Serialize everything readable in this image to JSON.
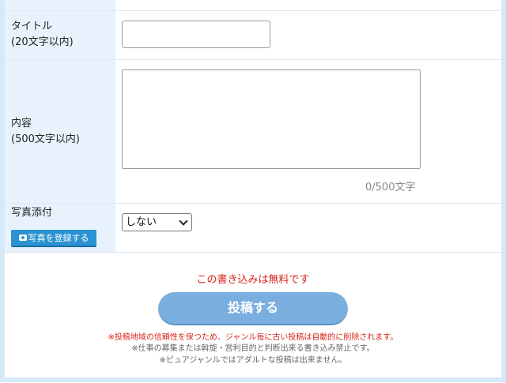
{
  "form": {
    "title_label_line1": "タイトル",
    "title_label_line2": "(20文字以内)",
    "title_value": "",
    "content_label_line1": "内容",
    "content_label_line2": "(500文字以内)",
    "content_value": "",
    "char_count": "0/500文字",
    "photo_label": "写真添付",
    "photo_select_value": "しない",
    "photo_upload_label": "写真を登録する"
  },
  "footer": {
    "free_note": "この書き込みは無料です",
    "submit_label": "投稿する",
    "notice_red": "※投稿地域の信頼性を保つため、ジャンル毎に古い投稿は自動的に削除されます。",
    "notice_gray_1": "※仕事の募集または斡旋・営利目的と判断出来る書き込み禁止です。",
    "notice_gray_2": "※ピュアジャンルではアダルトな投稿は出来ません。"
  },
  "colors": {
    "label_bg": "#e8f2fc",
    "accent_red": "#d7261b",
    "submit_bg": "#7aaedf",
    "upload_bg": "#2b93d1",
    "frame": "#d6e9f8"
  },
  "icons": {
    "upload": "camera-icon",
    "select": "chevron-down-icon",
    "textarea": "resize-grip-icon"
  }
}
